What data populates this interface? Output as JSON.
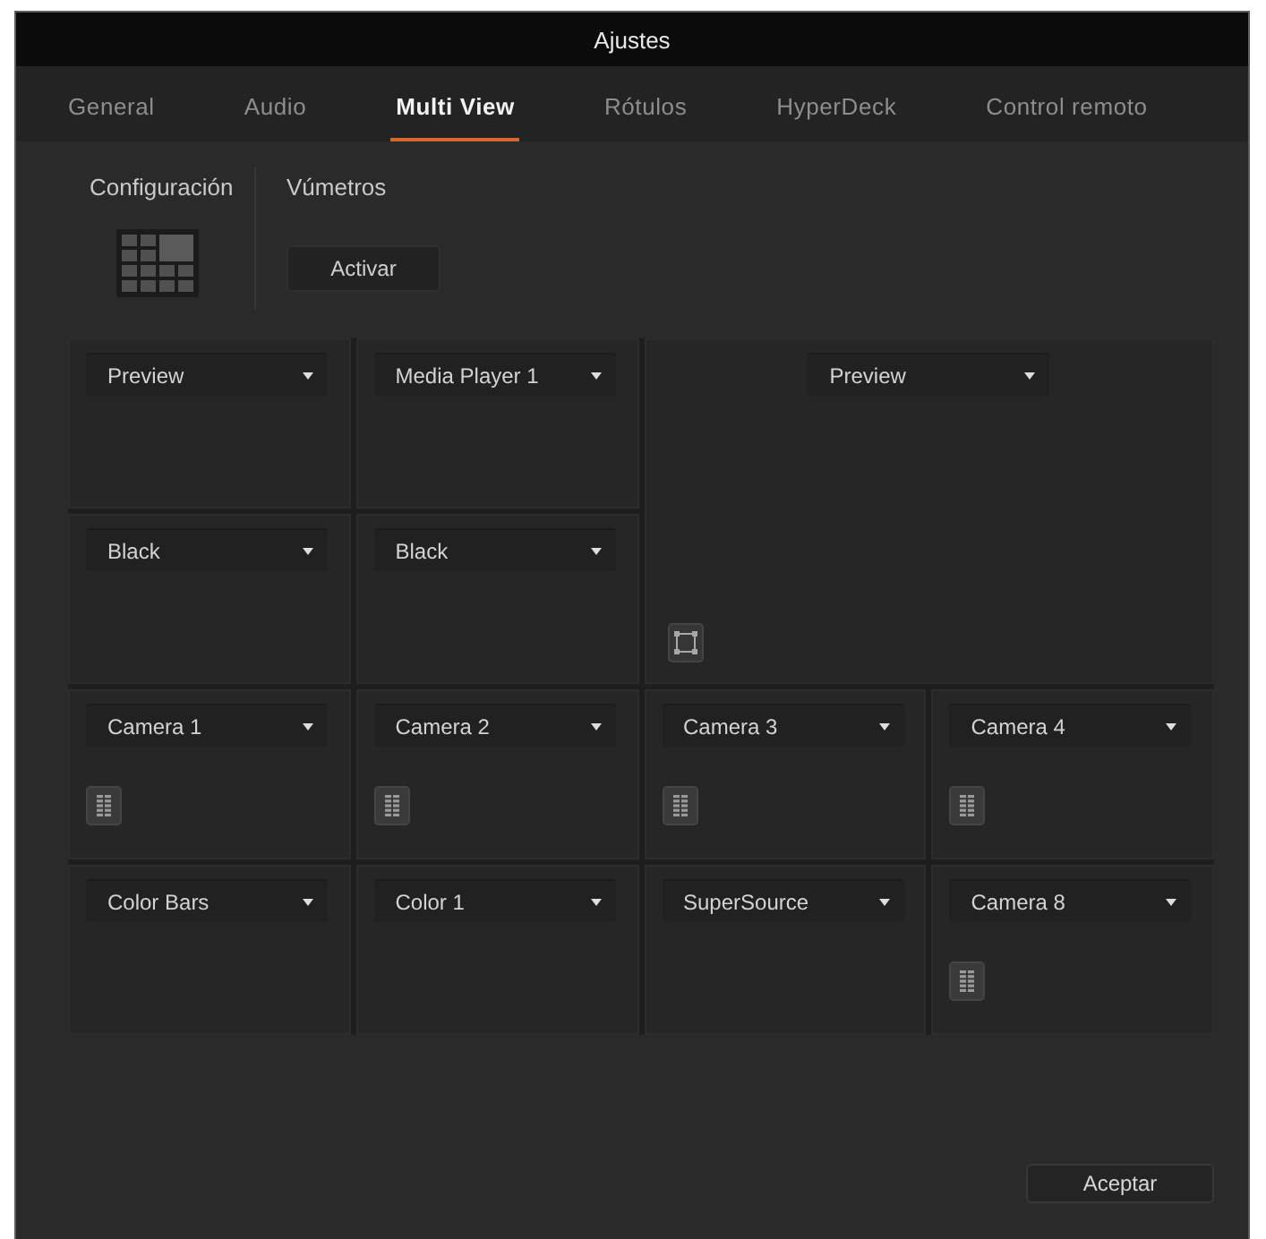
{
  "window": {
    "title": "Ajustes"
  },
  "tabs": [
    {
      "label": "General",
      "selected": false
    },
    {
      "label": "Audio",
      "selected": false
    },
    {
      "label": "Multi View",
      "selected": true
    },
    {
      "label": "Rótulos",
      "selected": false
    },
    {
      "label": "HyperDeck",
      "selected": false
    },
    {
      "label": "Control remoto",
      "selected": false
    }
  ],
  "layout": {
    "label": "Configuración"
  },
  "meters": {
    "label": "Vúmetros",
    "button": "Activar"
  },
  "views": [
    {
      "kind": "small",
      "source": "Preview",
      "meter_button": false
    },
    {
      "kind": "small",
      "source": "Media Player 1",
      "meter_button": false
    },
    {
      "kind": "large",
      "source": "Preview"
    },
    {
      "kind": "small",
      "source": "Black",
      "meter_button": false
    },
    {
      "kind": "small",
      "source": "Black",
      "meter_button": false
    },
    {
      "kind": "small",
      "source": "Camera 1",
      "meter_button": true
    },
    {
      "kind": "small",
      "source": "Camera 2",
      "meter_button": true
    },
    {
      "kind": "small",
      "source": "Camera 3",
      "meter_button": true
    },
    {
      "kind": "small",
      "source": "Camera 4",
      "meter_button": true
    },
    {
      "kind": "small",
      "source": "Color Bars",
      "meter_button": false
    },
    {
      "kind": "small",
      "source": "Color 1",
      "meter_button": false
    },
    {
      "kind": "small",
      "source": "SuperSource",
      "meter_button": false
    },
    {
      "kind": "small",
      "source": "Camera 8",
      "meter_button": true
    }
  ],
  "footer": {
    "button": "Aceptar"
  }
}
